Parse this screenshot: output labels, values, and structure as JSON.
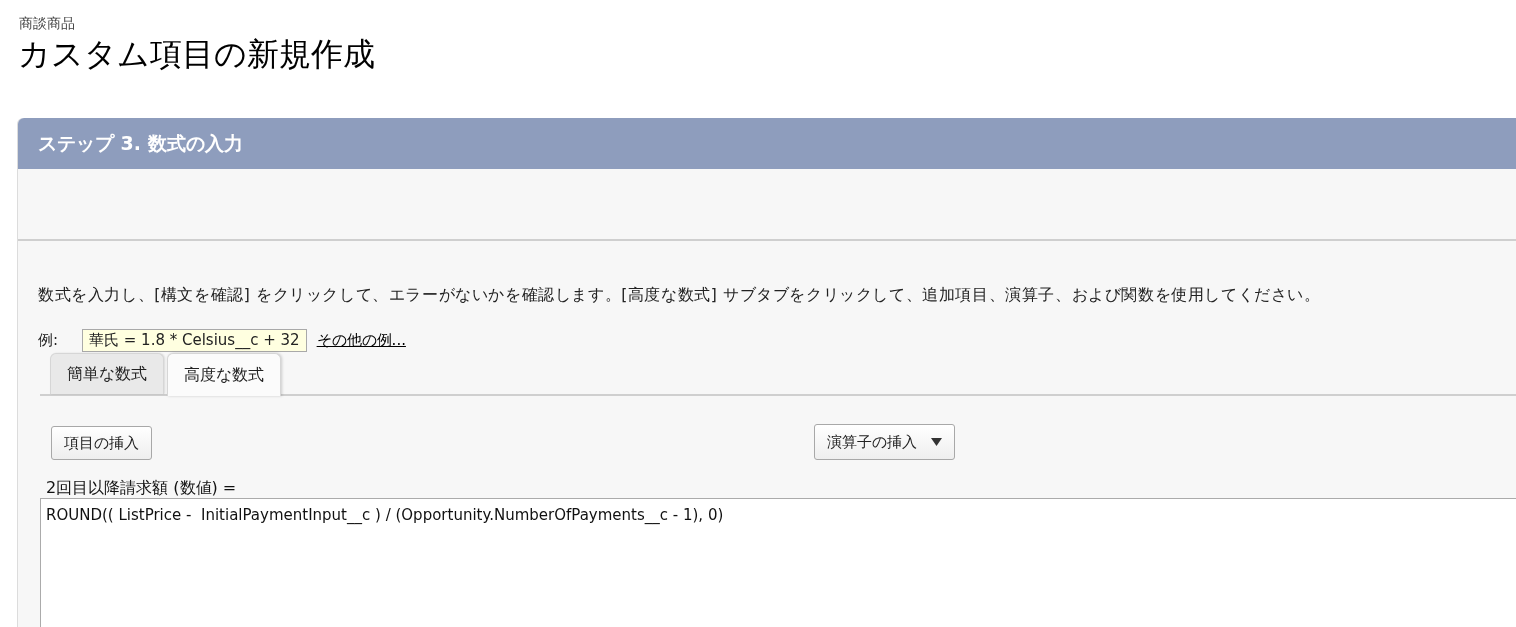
{
  "breadcrumb": "商談商品",
  "page_title": "カスタム項目の新規作成",
  "step_panel": {
    "title": "ステップ 3. 数式の入力"
  },
  "instructions": "数式を入力し、[構文を確認] をクリックして、エラーがないかを確認します。[高度な数式] サブタブをクリックして、追加項目、演算子、および関数を使用してください。",
  "example": {
    "label": "例:",
    "formula": "華氏 = 1.8 * Celsius__c + 32",
    "more_link": "その他の例..."
  },
  "tabs": [
    {
      "label": "簡単な数式",
      "selected": false
    },
    {
      "label": "高度な数式",
      "selected": true
    }
  ],
  "toolbar": {
    "insert_field_button": "項目の挿入",
    "insert_operator_button": "演算子の挿入"
  },
  "formula_editor": {
    "label": "2回目以降請求額 (数値) =",
    "value": "ROUND(( ListPrice -  InitialPaymentInput__c ) / (Opportunity.NumberOfPayments__c - 1), 0)"
  }
}
